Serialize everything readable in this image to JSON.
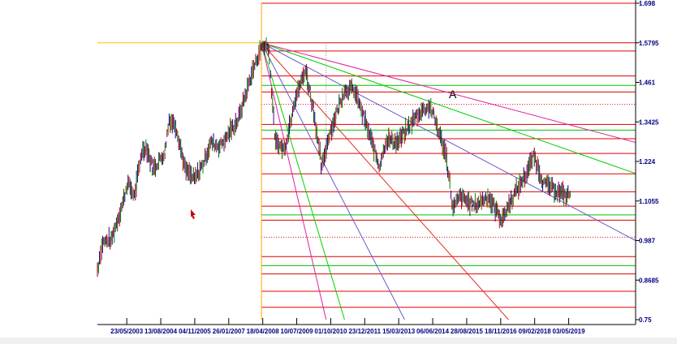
{
  "chart_data": {
    "type": "candlestick",
    "annotation_label": "A",
    "x_tick_labels": [
      "23/05/2003",
      "13/08/2004",
      "04/11/2005",
      "26/01/2007",
      "18/04/2008",
      "10/07/2009",
      "01/10/2010",
      "23/12/2011",
      "15/03/2013",
      "06/06/2014",
      "28/08/2015",
      "18/11/2016",
      "09/02/2018",
      "03/05/2019"
    ],
    "xlim": [
      "2002-05-01",
      "2021-10-01"
    ],
    "y_tick_labels": [
      "1.698",
      "1.5795",
      "1.461",
      "1.3425",
      "1.224",
      "1.1055",
      "0.987",
      "0.8685",
      "0.75"
    ],
    "y_ticks": [
      1.698,
      1.5795,
      1.461,
      1.3425,
      1.224,
      1.1055,
      0.987,
      0.8685,
      0.75
    ],
    "ylim": [
      0.75,
      1.698
    ],
    "price_path": [
      [
        "2002-05-01",
        0.9
      ],
      [
        "2002-07-01",
        0.98
      ],
      [
        "2002-11-01",
        0.99
      ],
      [
        "2003-04-01",
        1.1
      ],
      [
        "2003-06-01",
        1.16
      ],
      [
        "2003-09-01",
        1.12
      ],
      [
        "2003-12-01",
        1.25
      ],
      [
        "2004-02-01",
        1.27
      ],
      [
        "2004-05-01",
        1.2
      ],
      [
        "2004-10-01",
        1.25
      ],
      [
        "2004-12-01",
        1.35
      ],
      [
        "2005-03-01",
        1.33
      ],
      [
        "2005-07-01",
        1.2
      ],
      [
        "2005-11-01",
        1.17
      ],
      [
        "2006-03-01",
        1.22
      ],
      [
        "2006-06-01",
        1.28
      ],
      [
        "2006-10-01",
        1.27
      ],
      [
        "2007-01-01",
        1.3
      ],
      [
        "2007-06-01",
        1.35
      ],
      [
        "2007-11-01",
        1.47
      ],
      [
        "2008-04-01",
        1.57
      ],
      [
        "2008-07-01",
        1.57
      ],
      [
        "2008-10-01",
        1.28
      ],
      [
        "2009-02-01",
        1.26
      ],
      [
        "2009-06-01",
        1.4
      ],
      [
        "2009-11-01",
        1.5
      ],
      [
        "2010-03-01",
        1.36
      ],
      [
        "2010-06-01",
        1.2
      ],
      [
        "2010-09-01",
        1.3
      ],
      [
        "2011-04-01",
        1.44
      ],
      [
        "2011-08-01",
        1.44
      ],
      [
        "2012-02-01",
        1.32
      ],
      [
        "2012-07-01",
        1.21
      ],
      [
        "2012-10-01",
        1.29
      ],
      [
        "2013-03-01",
        1.28
      ],
      [
        "2013-07-01",
        1.32
      ],
      [
        "2013-12-01",
        1.37
      ],
      [
        "2014-05-01",
        1.39
      ],
      [
        "2014-08-01",
        1.33
      ],
      [
        "2014-12-01",
        1.24
      ],
      [
        "2015-03-01",
        1.08
      ],
      [
        "2015-06-01",
        1.12
      ],
      [
        "2015-12-01",
        1.09
      ],
      [
        "2016-06-01",
        1.12
      ],
      [
        "2016-12-01",
        1.05
      ],
      [
        "2017-05-01",
        1.12
      ],
      [
        "2017-10-01",
        1.18
      ],
      [
        "2018-02-01",
        1.24
      ],
      [
        "2018-06-01",
        1.16
      ],
      [
        "2018-11-01",
        1.14
      ],
      [
        "2019-04-01",
        1.12
      ],
      [
        "2019-06-01",
        1.13
      ]
    ],
    "vertical_line_x": "2008-04-01",
    "horizontal_line_y": 1.5795,
    "horizontal_levels": [
      {
        "y": 1.698,
        "color": "#e00000",
        "style": "solid"
      },
      {
        "y": 1.5795,
        "color": "#e00000",
        "style": "solid"
      },
      {
        "y": 1.555,
        "color": "#e00000",
        "style": "solid"
      },
      {
        "y": 1.48,
        "color": "#e00000",
        "style": "solid"
      },
      {
        "y": 1.452,
        "color": "#00c000",
        "style": "solid"
      },
      {
        "y": 1.432,
        "color": "#e00000",
        "style": "solid"
      },
      {
        "y": 1.395,
        "color": "#e00000",
        "style": "dotted"
      },
      {
        "y": 1.335,
        "color": "#e00000",
        "style": "solid"
      },
      {
        "y": 1.318,
        "color": "#00c000",
        "style": "solid"
      },
      {
        "y": 1.292,
        "color": "#e00000",
        "style": "solid"
      },
      {
        "y": 1.248,
        "color": "#e00000",
        "style": "solid"
      },
      {
        "y": 1.187,
        "color": "#e00000",
        "style": "solid"
      },
      {
        "y": 1.133,
        "color": "#e00000",
        "style": "solid"
      },
      {
        "y": 1.09,
        "color": "#e00000",
        "style": "solid"
      },
      {
        "y": 1.064,
        "color": "#00c000",
        "style": "solid"
      },
      {
        "y": 1.048,
        "color": "#e00000",
        "style": "solid"
      },
      {
        "y": 0.997,
        "color": "#e00000",
        "style": "dotted"
      },
      {
        "y": 0.939,
        "color": "#e00000",
        "style": "solid"
      },
      {
        "y": 0.912,
        "color": "#00c000",
        "style": "solid"
      },
      {
        "y": 0.887,
        "color": "#e00000",
        "style": "solid"
      },
      {
        "y": 0.835,
        "color": "#e00000",
        "style": "solid"
      },
      {
        "y": 0.787,
        "color": "#e00000",
        "style": "solid"
      }
    ],
    "fan_lines": [
      {
        "x2": "2021-10-01",
        "y2": 1.281,
        "color": "#e020a0"
      },
      {
        "x2": "2021-10-01",
        "y2": 1.188,
        "color": "#00d000"
      },
      {
        "x2": "2021-10-01",
        "y2": 0.987,
        "color": "#6a5acd"
      },
      {
        "x2": "2017-03-01",
        "y2": 0.75,
        "color": "#e03020"
      },
      {
        "x2": "2013-06-01",
        "y2": 0.75,
        "color": "#6a5acd"
      },
      {
        "x2": "2011-04-01",
        "y2": 0.75,
        "color": "#00d000"
      },
      {
        "x2": "2010-08-01",
        "y2": 0.75,
        "color": "#e020a0"
      }
    ]
  }
}
